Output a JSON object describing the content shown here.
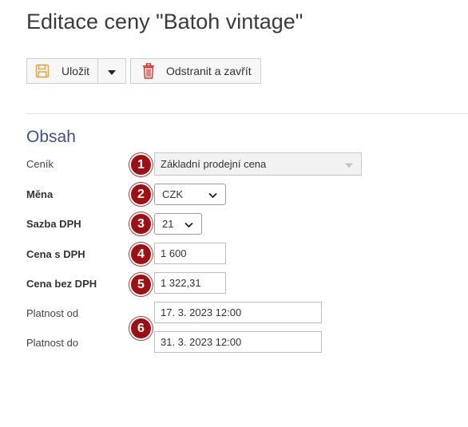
{
  "page": {
    "title": "Editace ceny \"Batoh vintage\""
  },
  "toolbar": {
    "save_label": "Uložit",
    "delete_label": "Odstranit a zavřít",
    "colors": {
      "save_icon": "#e8a23a",
      "delete_icon": "#d9302c"
    }
  },
  "section": {
    "title": "Obsah"
  },
  "form": {
    "fields": [
      {
        "label": "Ceník",
        "value": "Základní prodejní cena",
        "badge": "1"
      },
      {
        "label": "Měna",
        "value": "CZK",
        "badge": "2"
      },
      {
        "label": "Sazba DPH",
        "value": "21",
        "badge": "3"
      },
      {
        "label": "Cena s DPH",
        "value": "1 600",
        "badge": "4"
      },
      {
        "label": "Cena bez DPH",
        "value": "1 322,31",
        "badge": "5"
      },
      {
        "label": "Platnost od",
        "value": "17. 3. 2023 12:00"
      },
      {
        "label": "Platnost do",
        "value": "31. 3. 2023 12:00"
      }
    ],
    "date_badge": "6"
  },
  "colors": {
    "accent": "#3f4e8c",
    "badge": "#9e0f14"
  }
}
